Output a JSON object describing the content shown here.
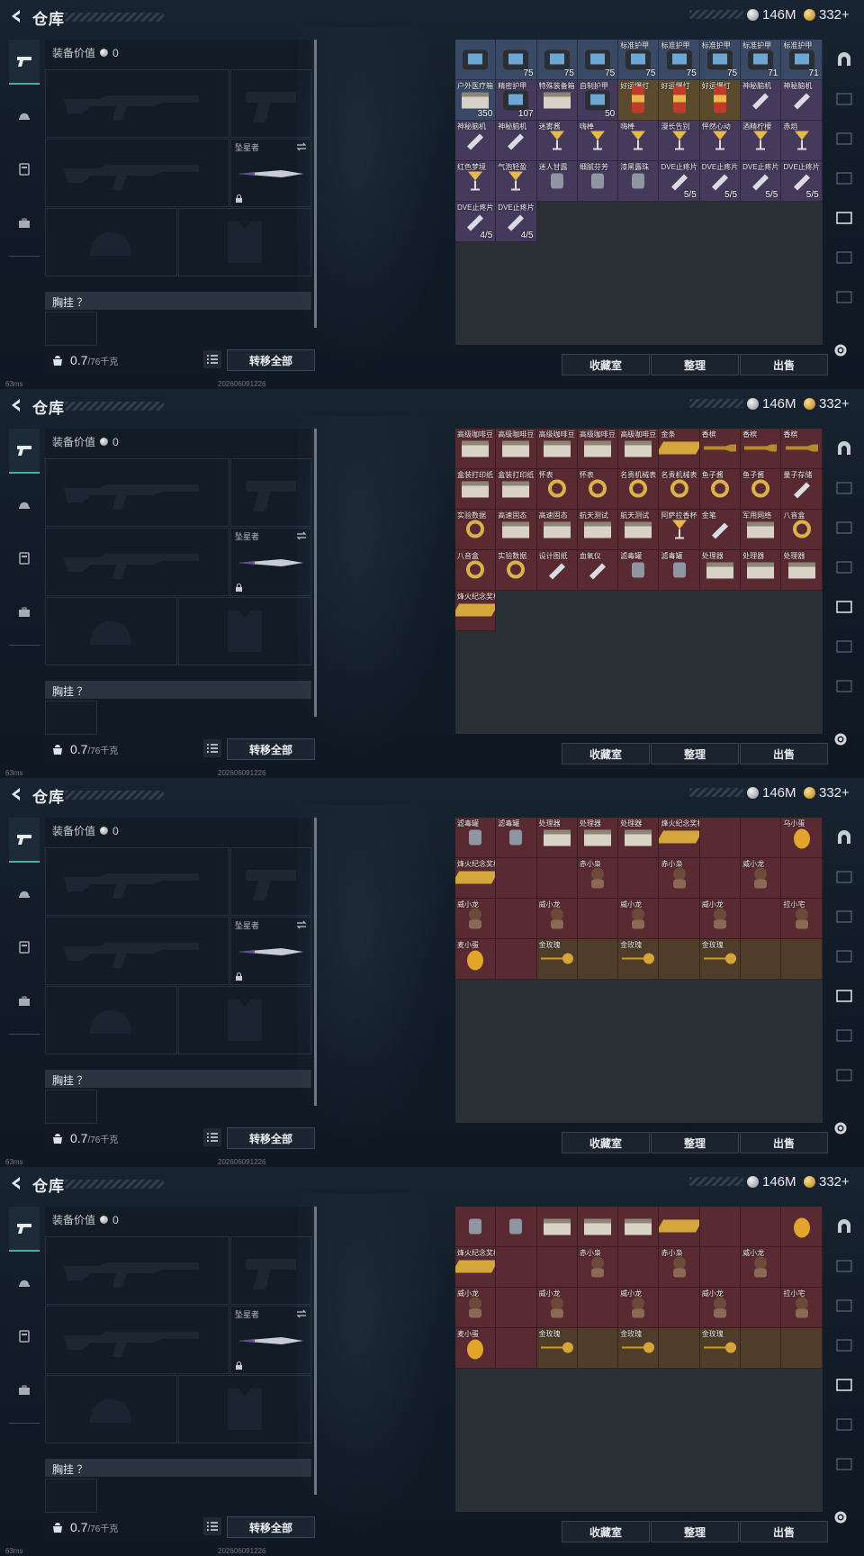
{
  "header": {
    "title": "仓库",
    "silver": "146M",
    "gold": "332+"
  },
  "equipment": {
    "value_label": "装备价值",
    "value": "0",
    "melee_label": "坠星者",
    "chest_label": "胸挂 ？",
    "weight_value": "0.7",
    "weight_max": "/76千克",
    "transfer_all": "转移全部"
  },
  "footer": {
    "ping": "63ms",
    "timestamp": "202606091226"
  },
  "buttons": {
    "collection": "收藏室",
    "organize": "整理",
    "sell": "出售"
  },
  "panels": [
    {
      "cells": [
        {
          "n": "",
          "c": "",
          "bg": "blue",
          "i": "armor"
        },
        {
          "n": "",
          "c": "75",
          "bg": "blue",
          "i": "armor"
        },
        {
          "n": "",
          "c": "75",
          "bg": "blue",
          "i": "armor"
        },
        {
          "n": "",
          "c": "75",
          "bg": "blue",
          "i": "armor"
        },
        {
          "n": "标准护甲",
          "c": "75",
          "bg": "blue",
          "i": "armor"
        },
        {
          "n": "标准护甲",
          "c": "75",
          "bg": "blue",
          "i": "armor"
        },
        {
          "n": "标准护甲",
          "c": "75",
          "bg": "blue",
          "i": "armor"
        },
        {
          "n": "标准护甲",
          "c": "71",
          "bg": "blue",
          "i": "armor"
        },
        {
          "n": "标准护甲",
          "c": "71",
          "bg": "blue",
          "i": "armor"
        },
        {
          "n": "户外医疗箱",
          "c": "350",
          "bg": "blue",
          "i": "box"
        },
        {
          "n": "精密护甲",
          "c": "107",
          "bg": "purple",
          "i": "armor"
        },
        {
          "n": "特殊装备箱",
          "c": "",
          "bg": "purple",
          "i": "box"
        },
        {
          "n": "自制护甲",
          "c": "50",
          "bg": "purple",
          "i": "armor"
        },
        {
          "n": "好运爆灯",
          "c": "",
          "bg": "gold",
          "i": "can"
        },
        {
          "n": "好运爆灯",
          "c": "",
          "bg": "gold",
          "i": "can"
        },
        {
          "n": "好运爆灯",
          "c": "",
          "bg": "gold",
          "i": "can"
        },
        {
          "n": "神秘脑机",
          "c": "",
          "bg": "purple",
          "i": "tube"
        },
        {
          "n": "神秘脑机",
          "c": "",
          "bg": "purple",
          "i": "tube"
        },
        {
          "n": "神秘脑机",
          "c": "",
          "bg": "purple",
          "i": "tube"
        },
        {
          "n": "神秘脑机",
          "c": "",
          "bg": "purple",
          "i": "tube"
        },
        {
          "n": "迷雾酱",
          "c": "",
          "bg": "purple",
          "i": "cocktail"
        },
        {
          "n": "嗨棒",
          "c": "",
          "bg": "purple",
          "i": "cocktail"
        },
        {
          "n": "嗨棒",
          "c": "",
          "bg": "purple",
          "i": "cocktail"
        },
        {
          "n": "漫长告别",
          "c": "",
          "bg": "purple",
          "i": "cocktail"
        },
        {
          "n": "怦然心动",
          "c": "",
          "bg": "purple",
          "i": "cocktail"
        },
        {
          "n": "酒精柠檬",
          "c": "",
          "bg": "purple",
          "i": "cocktail"
        },
        {
          "n": "赤焰",
          "c": "",
          "bg": "purple",
          "i": "cocktail"
        },
        {
          "n": "红色梦境",
          "c": "",
          "bg": "purple",
          "i": "cocktail"
        },
        {
          "n": "气泡轻盈",
          "c": "",
          "bg": "purple",
          "i": "cocktail"
        },
        {
          "n": "迷人甘露",
          "c": "",
          "bg": "purple",
          "i": "jar"
        },
        {
          "n": "细腻芬芳",
          "c": "",
          "bg": "purple",
          "i": "jar"
        },
        {
          "n": "漆黑露珠",
          "c": "",
          "bg": "purple",
          "i": "jar"
        },
        {
          "n": "DVE止疼片",
          "c": "5/5",
          "bg": "purple",
          "i": "tube"
        },
        {
          "n": "DVE止疼片",
          "c": "5/5",
          "bg": "purple",
          "i": "tube"
        },
        {
          "n": "DVE止疼片",
          "c": "5/5",
          "bg": "purple",
          "i": "tube"
        },
        {
          "n": "DVE止疼片",
          "c": "5/5",
          "bg": "purple",
          "i": "tube"
        },
        {
          "n": "DVE止疼片",
          "c": "4/5",
          "bg": "purple",
          "i": "tube"
        },
        {
          "n": "DVE止疼片",
          "c": "4/5",
          "bg": "purple",
          "i": "tube"
        }
      ]
    },
    {
      "cells": [
        {
          "n": "高级咖啡豆",
          "c": "",
          "bg": "red",
          "i": "box"
        },
        {
          "n": "高级咖啡豆",
          "c": "",
          "bg": "red",
          "i": "box"
        },
        {
          "n": "高级咖啡豆",
          "c": "",
          "bg": "red",
          "i": "box"
        },
        {
          "n": "高级咖啡豆",
          "c": "",
          "bg": "red",
          "i": "box"
        },
        {
          "n": "高级咖啡豆",
          "c": "",
          "bg": "red",
          "i": "box"
        },
        {
          "n": "金条",
          "c": "",
          "bg": "red",
          "i": "bar"
        },
        {
          "n": "香槟",
          "c": "",
          "bg": "red",
          "i": "bottle"
        },
        {
          "n": "香槟",
          "c": "",
          "bg": "red",
          "i": "bottle"
        },
        {
          "n": "香槟",
          "c": "",
          "bg": "red",
          "i": "bottle"
        },
        {
          "n": "盒装打印纸",
          "c": "",
          "bg": "red",
          "i": "box"
        },
        {
          "n": "盒装打印纸",
          "c": "",
          "bg": "red",
          "i": "box"
        },
        {
          "n": "怀表",
          "c": "",
          "bg": "red",
          "i": "ring"
        },
        {
          "n": "怀表",
          "c": "",
          "bg": "red",
          "i": "ring"
        },
        {
          "n": "名贵机械表",
          "c": "",
          "bg": "red",
          "i": "ring"
        },
        {
          "n": "名贵机械表",
          "c": "",
          "bg": "red",
          "i": "ring"
        },
        {
          "n": "鱼子酱",
          "c": "",
          "bg": "red",
          "i": "ring"
        },
        {
          "n": "鱼子酱",
          "c": "",
          "bg": "red",
          "i": "ring"
        },
        {
          "n": "量子存储",
          "c": "",
          "bg": "red",
          "i": "tube"
        },
        {
          "n": "实验数据",
          "c": "",
          "bg": "red",
          "i": "ring"
        },
        {
          "n": "高速固态",
          "c": "",
          "bg": "red",
          "i": "box"
        },
        {
          "n": "高速固态",
          "c": "",
          "bg": "red",
          "i": "box"
        },
        {
          "n": "航天测试",
          "c": "",
          "bg": "red",
          "i": "box"
        },
        {
          "n": "航天测试",
          "c": "",
          "bg": "red",
          "i": "box"
        },
        {
          "n": "阿萨拉香杯",
          "c": "",
          "bg": "red",
          "i": "cocktail"
        },
        {
          "n": "金笔",
          "c": "",
          "bg": "red",
          "i": "tube"
        },
        {
          "n": "军用网络",
          "c": "",
          "bg": "red",
          "i": "box"
        },
        {
          "n": "八音盒",
          "c": "",
          "bg": "red",
          "i": "ring"
        },
        {
          "n": "八音盒",
          "c": "",
          "bg": "red",
          "i": "ring"
        },
        {
          "n": "实验数据",
          "c": "",
          "bg": "red",
          "i": "ring"
        },
        {
          "n": "设计图纸",
          "c": "",
          "bg": "red",
          "i": "tube"
        },
        {
          "n": "血氧仪",
          "c": "",
          "bg": "red",
          "i": "tube"
        },
        {
          "n": "滤毒罐",
          "c": "",
          "bg": "red",
          "i": "jar"
        },
        {
          "n": "滤毒罐",
          "c": "",
          "bg": "red",
          "i": "jar"
        },
        {
          "n": "处理器",
          "c": "",
          "bg": "red",
          "i": "box"
        },
        {
          "n": "处理器",
          "c": "",
          "bg": "red",
          "i": "box"
        },
        {
          "n": "处理器",
          "c": "",
          "bg": "red",
          "i": "box"
        },
        {
          "n": "烽火纪念奖杯",
          "c": "",
          "bg": "red",
          "i": "bar"
        }
      ]
    },
    {
      "cells": [
        {
          "n": "滤毒罐",
          "c": "",
          "bg": "red",
          "i": "jar"
        },
        {
          "n": "滤毒罐",
          "c": "",
          "bg": "red",
          "i": "jar"
        },
        {
          "n": "处理器",
          "c": "",
          "bg": "red",
          "i": "box"
        },
        {
          "n": "处理器",
          "c": "",
          "bg": "red",
          "i": "box"
        },
        {
          "n": "处理器",
          "c": "",
          "bg": "red",
          "i": "box"
        },
        {
          "n": "烽火纪念奖杯",
          "c": "",
          "bg": "red",
          "i": "bar"
        },
        {
          "n": "",
          "c": "",
          "bg": "red",
          "i": ""
        },
        {
          "n": "",
          "c": "",
          "bg": "red",
          "i": ""
        },
        {
          "n": "乌小蛋",
          "c": "",
          "bg": "red",
          "i": "egg"
        },
        {
          "n": "烽火纪念奖杯",
          "c": "",
          "bg": "red",
          "i": "bar"
        },
        {
          "n": "",
          "c": "",
          "bg": "red",
          "i": ""
        },
        {
          "n": "",
          "c": "",
          "bg": "red",
          "i": ""
        },
        {
          "n": "赤小枭",
          "c": "",
          "bg": "red",
          "i": "toy"
        },
        {
          "n": "",
          "c": "",
          "bg": "red",
          "i": ""
        },
        {
          "n": "赤小枭",
          "c": "",
          "bg": "red",
          "i": "toy"
        },
        {
          "n": "",
          "c": "",
          "bg": "red",
          "i": ""
        },
        {
          "n": "威小龙",
          "c": "",
          "bg": "red",
          "i": "toy"
        },
        {
          "n": "",
          "c": "",
          "bg": "red",
          "i": ""
        },
        {
          "n": "威小龙",
          "c": "",
          "bg": "red",
          "i": "toy"
        },
        {
          "n": "",
          "c": "",
          "bg": "red",
          "i": ""
        },
        {
          "n": "威小龙",
          "c": "",
          "bg": "red",
          "i": "toy"
        },
        {
          "n": "",
          "c": "",
          "bg": "red",
          "i": ""
        },
        {
          "n": "威小龙",
          "c": "",
          "bg": "red",
          "i": "toy"
        },
        {
          "n": "",
          "c": "",
          "bg": "red",
          "i": ""
        },
        {
          "n": "威小龙",
          "c": "",
          "bg": "red",
          "i": "toy"
        },
        {
          "n": "",
          "c": "",
          "bg": "red",
          "i": ""
        },
        {
          "n": "拉小宅",
          "c": "",
          "bg": "red",
          "i": "toy"
        },
        {
          "n": "麦小蛋",
          "c": "",
          "bg": "red",
          "i": "egg"
        },
        {
          "n": "",
          "c": "",
          "bg": "red",
          "i": ""
        },
        {
          "n": "金玫瑰",
          "c": "",
          "bg": "brown",
          "i": "rose"
        },
        {
          "n": "",
          "c": "",
          "bg": "brown",
          "i": ""
        },
        {
          "n": "金玫瑰",
          "c": "",
          "bg": "brown",
          "i": "rose"
        },
        {
          "n": "",
          "c": "",
          "bg": "brown",
          "i": ""
        },
        {
          "n": "金玫瑰",
          "c": "",
          "bg": "brown",
          "i": "rose"
        },
        {
          "n": "",
          "c": "",
          "bg": "brown",
          "i": ""
        },
        {
          "n": "",
          "c": "",
          "bg": "brown",
          "i": ""
        }
      ]
    },
    {
      "cells": [
        {
          "n": "",
          "c": "",
          "bg": "red",
          "i": "jar"
        },
        {
          "n": "",
          "c": "",
          "bg": "red",
          "i": "jar"
        },
        {
          "n": "",
          "c": "",
          "bg": "red",
          "i": "box"
        },
        {
          "n": "",
          "c": "",
          "bg": "red",
          "i": "box"
        },
        {
          "n": "",
          "c": "",
          "bg": "red",
          "i": "box"
        },
        {
          "n": "",
          "c": "",
          "bg": "red",
          "i": "bar"
        },
        {
          "n": "",
          "c": "",
          "bg": "red",
          "i": ""
        },
        {
          "n": "",
          "c": "",
          "bg": "red",
          "i": ""
        },
        {
          "n": "",
          "c": "",
          "bg": "red",
          "i": "egg"
        },
        {
          "n": "烽火纪念奖杯",
          "c": "",
          "bg": "red",
          "i": "bar"
        },
        {
          "n": "",
          "c": "",
          "bg": "red",
          "i": ""
        },
        {
          "n": "",
          "c": "",
          "bg": "red",
          "i": ""
        },
        {
          "n": "赤小枭",
          "c": "",
          "bg": "red",
          "i": "toy"
        },
        {
          "n": "",
          "c": "",
          "bg": "red",
          "i": ""
        },
        {
          "n": "赤小枭",
          "c": "",
          "bg": "red",
          "i": "toy"
        },
        {
          "n": "",
          "c": "",
          "bg": "red",
          "i": ""
        },
        {
          "n": "威小龙",
          "c": "",
          "bg": "red",
          "i": "toy"
        },
        {
          "n": "",
          "c": "",
          "bg": "red",
          "i": ""
        },
        {
          "n": "威小龙",
          "c": "",
          "bg": "red",
          "i": "toy"
        },
        {
          "n": "",
          "c": "",
          "bg": "red",
          "i": ""
        },
        {
          "n": "威小龙",
          "c": "",
          "bg": "red",
          "i": "toy"
        },
        {
          "n": "",
          "c": "",
          "bg": "red",
          "i": ""
        },
        {
          "n": "威小龙",
          "c": "",
          "bg": "red",
          "i": "toy"
        },
        {
          "n": "",
          "c": "",
          "bg": "red",
          "i": ""
        },
        {
          "n": "威小龙",
          "c": "",
          "bg": "red",
          "i": "toy"
        },
        {
          "n": "",
          "c": "",
          "bg": "red",
          "i": ""
        },
        {
          "n": "拉小宅",
          "c": "",
          "bg": "red",
          "i": "toy"
        },
        {
          "n": "麦小蛋",
          "c": "",
          "bg": "red",
          "i": "egg"
        },
        {
          "n": "",
          "c": "",
          "bg": "red",
          "i": ""
        },
        {
          "n": "金玫瑰",
          "c": "",
          "bg": "brown",
          "i": "rose"
        },
        {
          "n": "",
          "c": "",
          "bg": "brown",
          "i": ""
        },
        {
          "n": "金玫瑰",
          "c": "",
          "bg": "brown",
          "i": "rose"
        },
        {
          "n": "",
          "c": "",
          "bg": "brown",
          "i": ""
        },
        {
          "n": "金玫瑰",
          "c": "",
          "bg": "brown",
          "i": "rose"
        },
        {
          "n": "",
          "c": "",
          "bg": "brown",
          "i": ""
        },
        {
          "n": "",
          "c": "",
          "bg": "brown",
          "i": ""
        }
      ]
    }
  ]
}
